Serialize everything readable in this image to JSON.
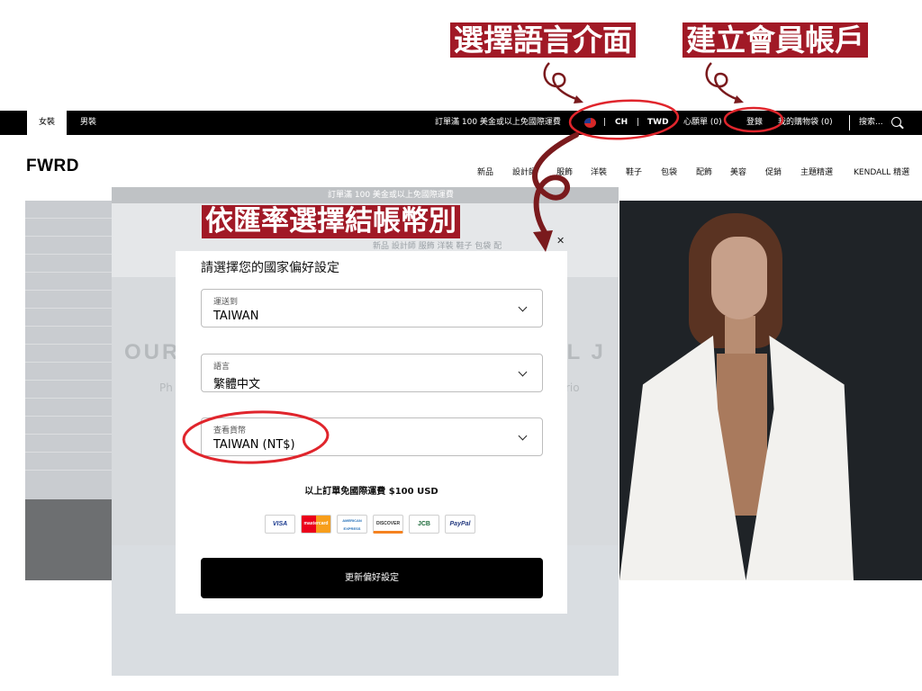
{
  "annotations": {
    "language": "選擇語言介面",
    "account": "建立會員帳戶",
    "currency": "依匯率選擇結帳幣別"
  },
  "topbar": {
    "tab_women": "女裝",
    "tab_men": "男裝",
    "promo": "訂單滿 100 美金或以上免國際運費",
    "lang": "CH",
    "currency": "TWD",
    "sep": "|",
    "wishlist": "心願單 (0)",
    "login": "登錄",
    "bag": "我的購物袋 (0)",
    "search": "搜索..."
  },
  "header": {
    "logo": "FWRD",
    "nav": [
      "新品",
      "設計師",
      "服飾",
      "洋裝",
      "鞋子",
      "包袋",
      "配飾",
      "美容",
      "促銷",
      "主題精選",
      "KENDALL 精選"
    ]
  },
  "background": {
    "ghost_topbar": "訂單滿 100 美金或以上免國際運費",
    "ghost_nav": "新品   設計師   服飾   洋裝   鞋子   包袋   配",
    "ghost_title_left": "OUR",
    "ghost_title_right": "LL J",
    "ghost_sub_left": "Ph",
    "ghost_sub_right": "rio"
  },
  "modal": {
    "title": "請選擇您的國家偏好設定",
    "close": "✕",
    "ship_to": {
      "label": "運送到",
      "value": "TAIWAN"
    },
    "language": {
      "label": "語言",
      "value": "繁體中文"
    },
    "currency": {
      "label": "查看貨幣",
      "value": "TAIWAN (NT$)"
    },
    "free_shipping": "以上訂單免國際運費 $100 USD",
    "cards": [
      "VISA",
      "mastercard",
      "AMERICAN EXPRESS",
      "DISCOVER",
      "JCB",
      "PayPal"
    ],
    "update_button": "更新偏好設定"
  },
  "colors": {
    "annotation_bg": "#a11926",
    "ink": "#7a1a1d",
    "highlight_circle": "#e0252c"
  }
}
